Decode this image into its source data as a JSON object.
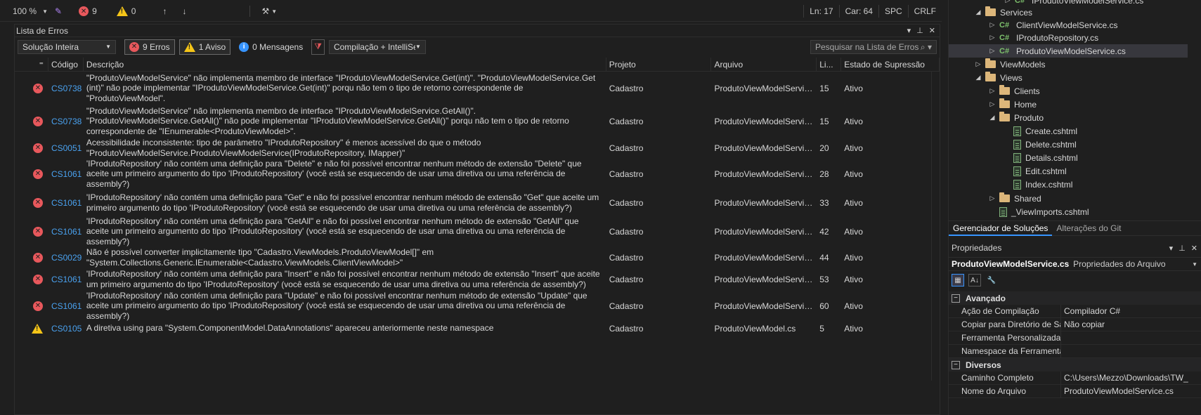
{
  "statusbar": {
    "zoom": "100 %",
    "errors": "9",
    "warnings": "0",
    "line": "Ln: 17",
    "col": "Car: 64",
    "spc": "SPC",
    "crlf": "CRLF"
  },
  "error_list": {
    "title": "Lista de Erros",
    "scope": "Solução Inteira",
    "errors_btn": "9 Erros",
    "warnings_btn": "1 Aviso",
    "messages_btn": "0 Mensagens",
    "source": "Compilação + IntelliSens",
    "search_placeholder": "Pesquisar na Lista de Erros",
    "headers": {
      "code": "Código",
      "description": "Descrição",
      "project": "Projeto",
      "file": "Arquivo",
      "line": "Li...",
      "state": "Estado de Supressão"
    },
    "rows": [
      {
        "severity": "error",
        "code": "CS0738",
        "description": "\"ProdutoViewModelService\" não implementa membro de interface \"IProdutoViewModelService.Get(int)\". \"ProdutoViewModelService.Get (int)\" não pode implementar \"IProdutoViewModelService.Get(int)\" porqu não tem o tipo de retorno correspondente de \"ProdutoViewModel\".",
        "project": "Cadastro",
        "file": "ProdutoViewModelService...",
        "line": "15",
        "state": "Ativo"
      },
      {
        "severity": "error",
        "code": "CS0738",
        "description": "\"ProdutoViewModelService\" não implementa membro de interface \"IProdutoViewModelService.GetAll()\". \"ProdutoViewModelService.GetAll()\" não pode implementar \"IProdutoViewModelService.GetAll()\" porqu não tem o tipo de retorno correspondente de \"IEnumerable<ProdutoViewModel>\".",
        "project": "Cadastro",
        "file": "ProdutoViewModelService...",
        "line": "15",
        "state": "Ativo"
      },
      {
        "severity": "error",
        "code": "CS0051",
        "description": "Acessibilidade inconsistente: tipo de parâmetro \"IProdutoRepository\" é menos acessível do que o método \"ProdutoViewModelService.ProdutoViewModelService(IProdutoRepository, IMapper)\"",
        "project": "Cadastro",
        "file": "ProdutoViewModelService...",
        "line": "20",
        "state": "Ativo"
      },
      {
        "severity": "error",
        "code": "CS1061",
        "description": "'IProdutoRepository' não contém uma definição para \"Delete\" e não foi possível encontrar nenhum método de extensão \"Delete\" que aceite um primeiro argumento do tipo 'IProdutoRepository' (você está se esquecendo de usar uma diretiva ou uma referência de assembly?)",
        "project": "Cadastro",
        "file": "ProdutoViewModelService...",
        "line": "28",
        "state": "Ativo"
      },
      {
        "severity": "error",
        "code": "CS1061",
        "description": "'IProdutoRepository' não contém uma definição para \"Get\" e não foi possível encontrar nenhum método de extensão \"Get\" que aceite um primeiro argumento do tipo 'IProdutoRepository' (você está se esquecendo de usar uma diretiva ou uma referência de assembly?)",
        "project": "Cadastro",
        "file": "ProdutoViewModelService...",
        "line": "33",
        "state": "Ativo"
      },
      {
        "severity": "error",
        "code": "CS1061",
        "description": "'IProdutoRepository' não contém uma definição para \"GetAll\" e não foi possível encontrar nenhum método de extensão \"GetAll\" que aceite um primeiro argumento do tipo 'IProdutoRepository' (você está se esquecendo de usar uma diretiva ou uma referência de assembly?)",
        "project": "Cadastro",
        "file": "ProdutoViewModelService...",
        "line": "42",
        "state": "Ativo"
      },
      {
        "severity": "error",
        "code": "CS0029",
        "description": "Não é possível converter implicitamente tipo \"Cadastro.ViewModels.ProdutoViewModel[]\" em \"System.Collections.Generic.IEnumerable<Cadastro.ViewModels.ClientViewModel>\"",
        "project": "Cadastro",
        "file": "ProdutoViewModelService...",
        "line": "44",
        "state": "Ativo"
      },
      {
        "severity": "error",
        "code": "CS1061",
        "description": "'IProdutoRepository' não contém uma definição para \"Insert\" e não foi possível encontrar nenhum método de extensão \"Insert\" que aceite um primeiro argumento do tipo 'IProdutoRepository' (você está se esquecendo de usar uma diretiva ou uma referência de assembly?)",
        "project": "Cadastro",
        "file": "ProdutoViewModelService...",
        "line": "53",
        "state": "Ativo"
      },
      {
        "severity": "error",
        "code": "CS1061",
        "description": "'IProdutoRepository' não contém uma definição para \"Update\" e não foi possível encontrar nenhum método de extensão \"Update\" que aceite um primeiro argumento do tipo 'IProdutoRepository' (você está se esquecendo de usar uma diretiva ou uma referência de assembly?)",
        "project": "Cadastro",
        "file": "ProdutoViewModelService...",
        "line": "60",
        "state": "Ativo"
      },
      {
        "severity": "warning",
        "code": "CS0105",
        "description": "A diretiva using para \"System.ComponentModel.DataAnnotations\" apareceu anteriormente neste namespace",
        "project": "Cadastro",
        "file": "ProdutoViewModel.cs",
        "line": "5",
        "state": "Ativo"
      }
    ]
  },
  "solution_explorer": {
    "items": [
      {
        "label": "IProdutoViewModelService.cs",
        "type": "cs"
      },
      {
        "label": "Services",
        "type": "folder"
      },
      {
        "label": "ClientViewModelService.cs",
        "type": "cs"
      },
      {
        "label": "IProdutoRepository.cs",
        "type": "cs"
      },
      {
        "label": "ProdutoViewModelService.cs",
        "type": "cs"
      },
      {
        "label": "ViewModels",
        "type": "folder"
      },
      {
        "label": "Views",
        "type": "folder"
      },
      {
        "label": "Clients",
        "type": "folder"
      },
      {
        "label": "Home",
        "type": "folder"
      },
      {
        "label": "Produto",
        "type": "folder"
      },
      {
        "label": "Create.cshtml",
        "type": "cshtml"
      },
      {
        "label": "Delete.cshtml",
        "type": "cshtml"
      },
      {
        "label": "Details.cshtml",
        "type": "cshtml"
      },
      {
        "label": "Edit.cshtml",
        "type": "cshtml"
      },
      {
        "label": "Index.cshtml",
        "type": "cshtml"
      },
      {
        "label": "Shared",
        "type": "folder"
      },
      {
        "label": "_ViewImports.cshtml",
        "type": "cshtml"
      }
    ],
    "tab_solutions": "Gerenciador de Soluções",
    "tab_git": "Alterações do Git"
  },
  "properties": {
    "title": "Propriedades",
    "object": "ProdutoViewModelService.cs",
    "object_type": "Propriedades do Arquivo",
    "cat_advanced": "Avançado",
    "cat_misc": "Diversos",
    "rows": [
      {
        "name": "Ação de Compilação",
        "value": "Compilador C#"
      },
      {
        "name": "Copiar para Diretório de Saída",
        "value": "Não copiar"
      },
      {
        "name": "Ferramenta Personalizada",
        "value": ""
      },
      {
        "name": "Namespace da Ferramenta Personalizada",
        "value": ""
      },
      {
        "name": "Caminho Completo",
        "value": "C:\\Users\\Mezzo\\Downloads\\TW_"
      },
      {
        "name": "Nome do Arquivo",
        "value": "ProdutoViewModelService.cs"
      }
    ]
  }
}
